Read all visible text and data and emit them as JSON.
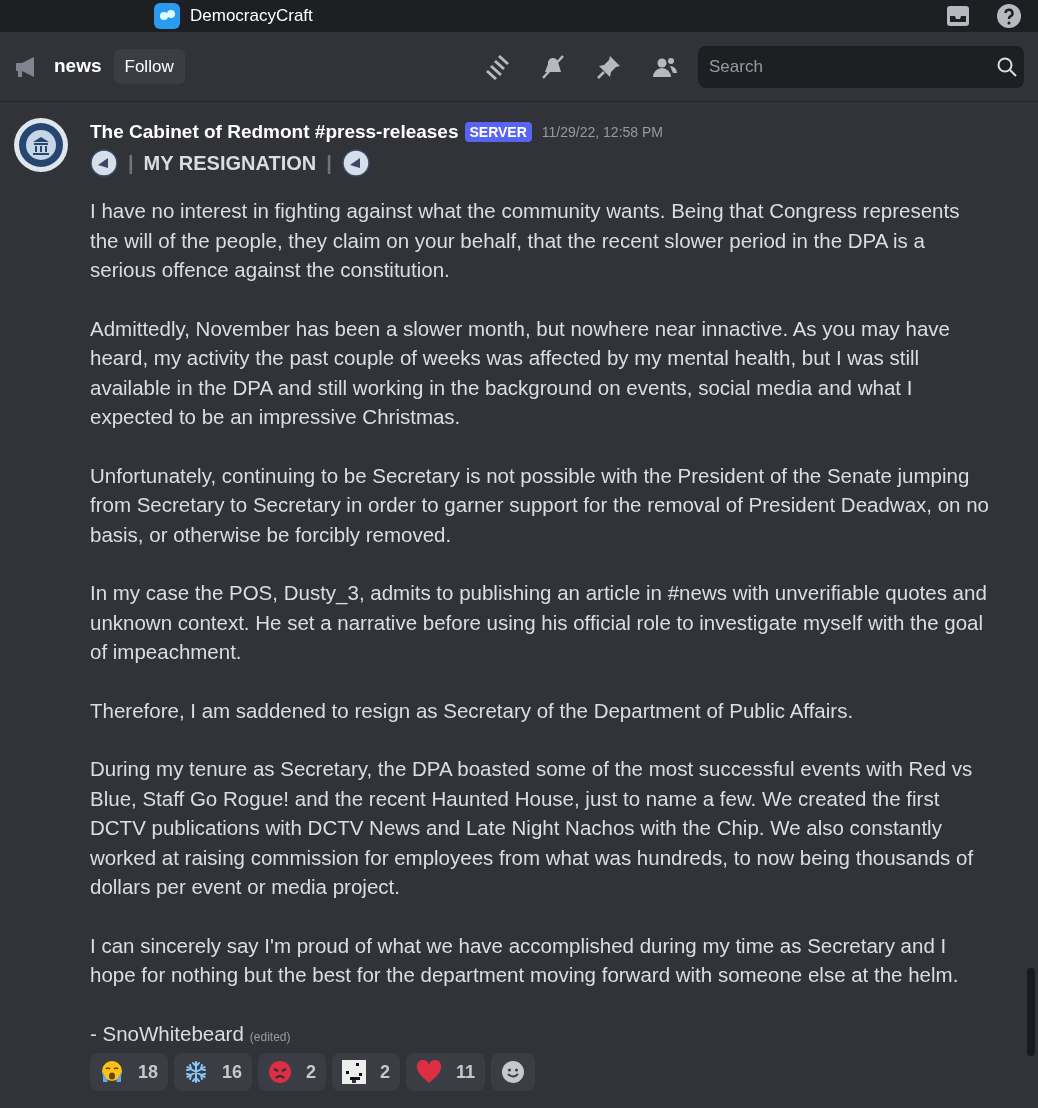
{
  "titlebar": {
    "server": "DemocracyCraft"
  },
  "channel_header": {
    "name": "news",
    "follow_button": "Follow",
    "search": {
      "placeholder": "Search"
    }
  },
  "message": {
    "author": "The Cabinet of Redmont #press-releases",
    "badge": "SERVER",
    "timestamp": "11/29/22, 12:58 PM",
    "separator_1": "|",
    "heading": "MY RESIGNATION",
    "separator_2": "|",
    "paragraphs": [
      "I have no interest in fighting against what the community wants. Being that Congress represents the will of the people, they claim on your behalf, that the recent slower period in the DPA is a serious offence against the constitution.",
      "Admittedly, November has been a slower month, but nowhere near innactive. As you may have heard, my activity the past couple of weeks was affected by my mental health, but I was still available in the DPA and still working in the background on events, social media and what I expected to be an impressive Christmas.",
      "Unfortunately, continuing to be Secretary is not possible with the President of the Senate jumping from Secretary to Secretary in order to garner support for the removal of President Deadwax, on no basis, or otherwise be forcibly removed.",
      "In my case the POS, Dusty_3, admits to publishing an article in #news with unverifiable quotes and unknown context. He set a narrative before using his official role to investigate myself with the goal of impeachment.",
      "Therefore, I am saddened to resign as Secretary of the Department of Public Affairs.",
      "During my tenure as Secretary, the DPA boasted some of the most successful events with Red vs Blue, Staff Go Rogue! and the recent Haunted House, just to name a few. We created the first DCTV publications with DCTV News and Late Night Nachos with the Chip. We also constantly worked at raising commission for employees from what was hundreds, to now being thousands of dollars per event or media project.",
      "I can sincerely say I'm proud of what we have accomplished during my time as Secretary and I hope for nothing but the best for the department moving forward with someone else at the helm."
    ],
    "signature": "- SnoWhitebeard",
    "edited": "(edited)",
    "reactions": [
      {
        "kind": "crying",
        "count": "18"
      },
      {
        "kind": "snowflake",
        "count": "16"
      },
      {
        "kind": "angry",
        "count": "2"
      },
      {
        "kind": "pixel",
        "count": "2"
      },
      {
        "kind": "heart",
        "count": "11"
      }
    ]
  }
}
